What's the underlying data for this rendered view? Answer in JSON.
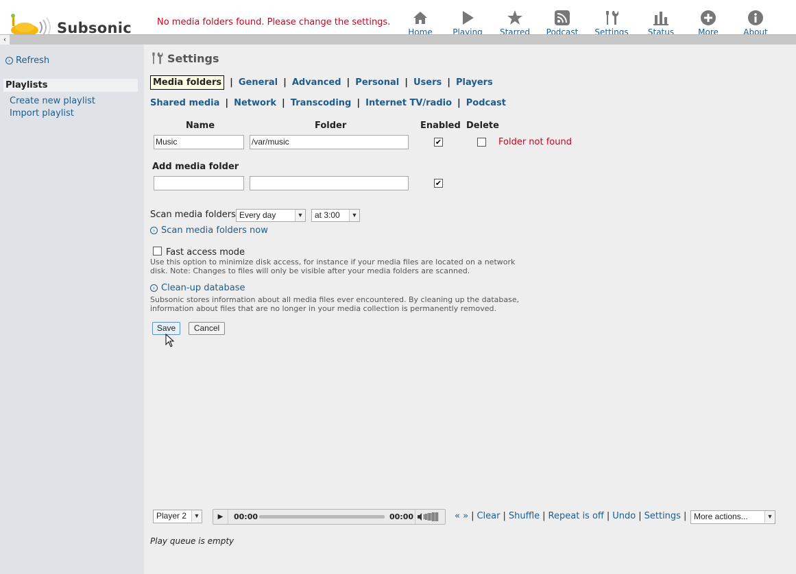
{
  "header": {
    "app_name": "Subsonic",
    "message": "No media folders found. Please change the settings.",
    "nav": [
      {
        "label": "Home",
        "icon": "home-icon"
      },
      {
        "label": "Playing",
        "icon": "play-icon"
      },
      {
        "label": "Starred",
        "icon": "star-icon"
      },
      {
        "label": "Podcast",
        "icon": "podcast-icon"
      },
      {
        "label": "Settings",
        "icon": "tools-icon"
      },
      {
        "label": "Status",
        "icon": "bar-chart-icon"
      },
      {
        "label": "More",
        "icon": "plus-circle-icon"
      },
      {
        "label": "About",
        "icon": "info-icon"
      }
    ]
  },
  "left": {
    "refresh": "Refresh",
    "playlists_header": "Playlists",
    "create_playlist": "Create new playlist",
    "import_playlist": "Import playlist"
  },
  "settings": {
    "title": "Settings",
    "tabs_row1": [
      "Media folders",
      "General",
      "Advanced",
      "Personal",
      "Users",
      "Players"
    ],
    "tabs_row2": [
      "Shared media",
      "Network",
      "Transcoding",
      "Internet TV/radio",
      "Podcast"
    ],
    "active_tab": "Media folders",
    "columns": {
      "name": "Name",
      "folder": "Folder",
      "enabled": "Enabled",
      "delete": "Delete"
    },
    "folders": [
      {
        "name": "Music",
        "path": "/var/music",
        "enabled": true,
        "delete": false,
        "status": "Folder not found"
      }
    ],
    "add_folder": {
      "label": "Add media folder",
      "name": "",
      "path": "",
      "enabled": true
    },
    "scan": {
      "label": "Scan media folders",
      "interval": "Every day",
      "time": "at 3:00",
      "scan_now": "Scan media folders now"
    },
    "fast_access": {
      "label": "Fast access mode",
      "checked": false,
      "desc_line1": "Use this option to minimize disk access, for instance if your media files are located on a network",
      "desc_line2": "disk. Note: Changes to files will only be visible after your media folders are scanned."
    },
    "cleanup": {
      "label": "Clean-up database",
      "desc_line1": "Subsonic stores information about all media files ever encountered. By cleaning up the database,",
      "desc_line2": "information about files that are no longer in your media collection is permanently removed."
    },
    "buttons": {
      "save": "Save",
      "cancel": "Cancel"
    }
  },
  "player": {
    "selected_player": "Player 2",
    "current_time": "00:00",
    "total_time": "00:00",
    "controls": {
      "prev": "«",
      "next": "»",
      "clear": "Clear",
      "shuffle": "Shuffle",
      "repeat": "Repeat is off",
      "undo": "Undo",
      "settings": "Settings"
    },
    "more_actions": "More actions...",
    "queue_status": "Play queue is empty"
  },
  "colors": {
    "accent_link": "#1d5c8c",
    "error": "#d0021b",
    "panel_bg": "#dfe3e8",
    "content_bg": "#eeeeee"
  }
}
